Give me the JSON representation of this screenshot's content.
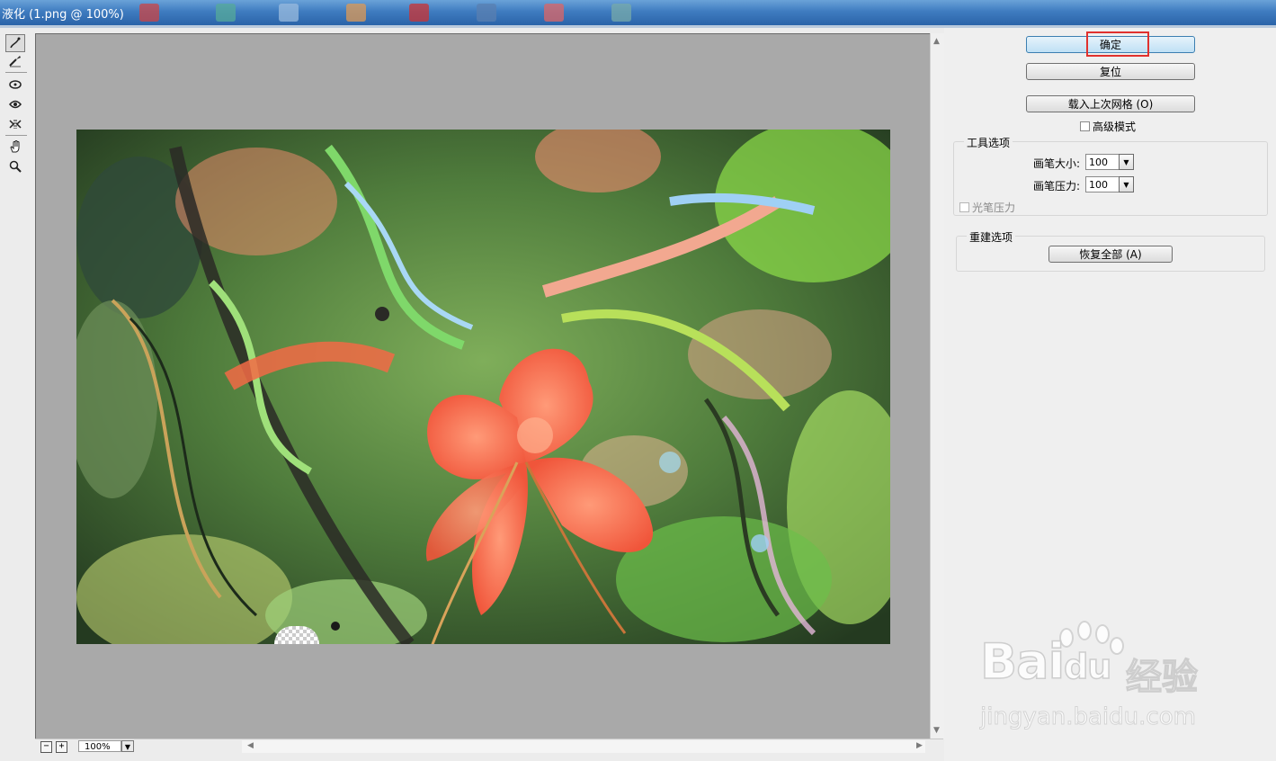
{
  "window": {
    "title": "液化 (1.png @ 100%)"
  },
  "tools": [
    {
      "name": "forward-warp-tool-icon",
      "active": true
    },
    {
      "name": "reconstruct-tool-icon",
      "active": false
    },
    {
      "name": "pucker-tool-icon",
      "active": false
    },
    {
      "name": "bloat-tool-icon",
      "active": false
    },
    {
      "name": "push-left-tool-icon",
      "active": false
    },
    {
      "name": "hand-tool-icon",
      "active": false
    },
    {
      "name": "zoom-tool-icon",
      "active": false
    }
  ],
  "statusbar": {
    "zoom_out": "−",
    "zoom_in": "+",
    "zoom_value": "100%"
  },
  "panel": {
    "ok_label": "确定",
    "reset_label": "复位",
    "load_mesh_label": "载入上次网格 (O)",
    "advanced_mode_label": "高级模式",
    "tool_options": {
      "title": "工具选项",
      "brush_size_label": "画笔大小:",
      "brush_size_value": "100",
      "brush_pressure_label": "画笔压力:",
      "brush_pressure_value": "100",
      "stylus_pressure_label": "光笔压力"
    },
    "reconstruct_options": {
      "title": "重建选项",
      "restore_all_label": "恢复全部 (A)"
    }
  },
  "watermark": {
    "logo_text": "Bai",
    "logo_du": "du",
    "logo_cn": "经验",
    "url": "jingyan.baidu.com"
  },
  "colors": {
    "canvas_bg": "#a9a9a9",
    "panel_bg": "#efefef",
    "highlight": "#e0312e",
    "title_bar": "#3f7cc0"
  }
}
